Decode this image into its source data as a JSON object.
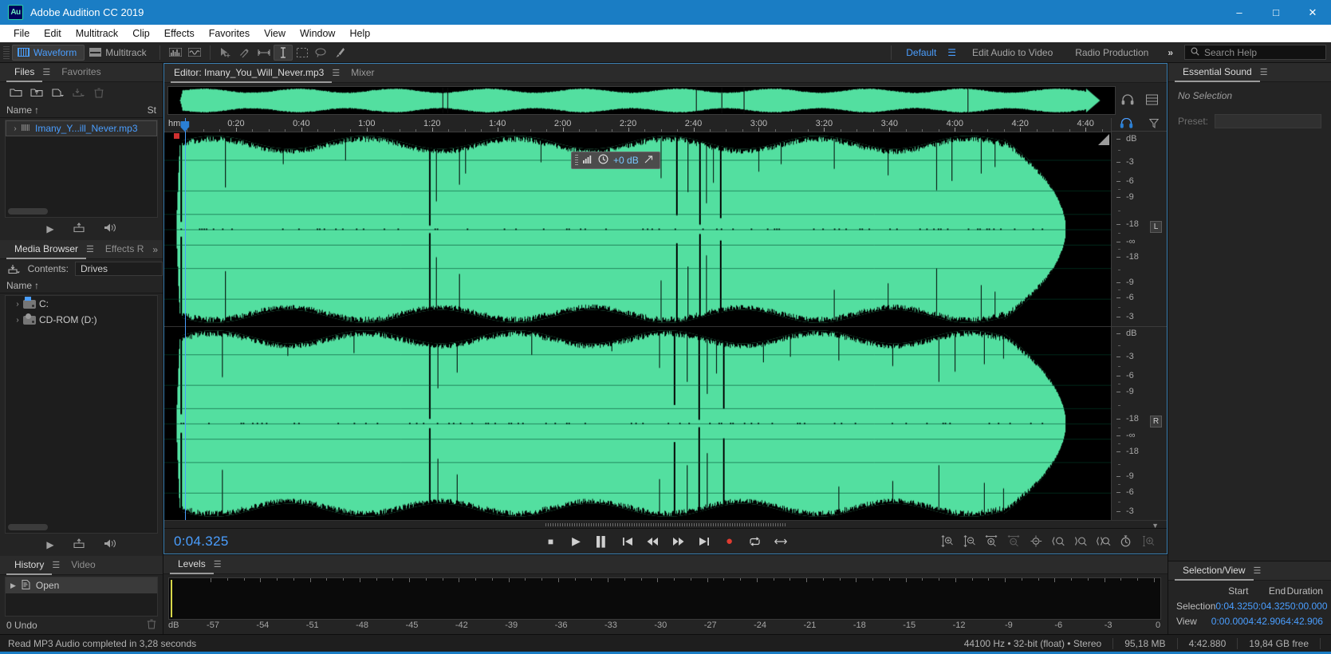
{
  "window": {
    "title": "Adobe Audition CC 2019",
    "logo": "Au",
    "minimize": "–",
    "maximize": "□",
    "close": "✕"
  },
  "menubar": [
    "File",
    "Edit",
    "Multitrack",
    "Clip",
    "Effects",
    "Favorites",
    "View",
    "Window",
    "Help"
  ],
  "toolbar": {
    "waveform": "Waveform",
    "multitrack": "Multitrack",
    "icons": [
      "spectral-frequency-icon",
      "spectral-pitch-icon",
      "move-tool-icon",
      "slip-tool-icon",
      "time-selection-icon",
      "razor-icon",
      "marquee-select-icon",
      "lasso-select-icon",
      "paintbrush-select-icon"
    ],
    "workspaces": [
      "Default",
      "Edit Audio to Video",
      "Radio Production"
    ],
    "workspace_active": "Default",
    "more": "»",
    "search_placeholder": "Search Help"
  },
  "files_panel": {
    "tabs": [
      "Files",
      "Favorites"
    ],
    "active_tab": "Files",
    "column_name": "Name",
    "column_sort_arrow": "↑",
    "column_status": "St",
    "items": [
      {
        "name": "Imany_Y...ill_Never.mp3",
        "selected": true
      }
    ],
    "toolbar_icons": [
      "open-file-icon",
      "import-file-icon",
      "new-file-icon",
      "save-icon",
      "close-file-icon"
    ],
    "transport_icons": [
      "play-icon",
      "insert-into-multitrack-icon",
      "auto-play-icon"
    ]
  },
  "media_browser": {
    "tabs": [
      "Media Browser",
      "Effects R"
    ],
    "active_tab": "Media Browser",
    "more": "»",
    "contents_label": "Contents:",
    "contents_value": "Drives",
    "column_name": "Name",
    "column_sort_arrow": "↑",
    "drives": [
      {
        "label": "C:",
        "icon": "hard-drive-icon"
      },
      {
        "label": "CD-ROM (D:)",
        "icon": "cd-rom-icon"
      }
    ],
    "transport_icons": [
      "play-icon",
      "insert-into-multitrack-icon",
      "auto-play-icon"
    ]
  },
  "history_panel": {
    "tabs": [
      "History",
      "Video"
    ],
    "active_tab": "History",
    "items": [
      {
        "label": "Open"
      }
    ],
    "undo_count": "0 Undo"
  },
  "editor": {
    "tabs": [
      "Editor: Imany_You_Will_Never.mp3",
      "Mixer"
    ],
    "active_tab": "Editor: Imany_You_Will_Never.mp3",
    "overview_icons": [
      "headphones-icon",
      "layout-icon"
    ],
    "ruler_unit": "hms",
    "ruler_labels": [
      "0:20",
      "0:40",
      "1:00",
      "1:20",
      "1:40",
      "2:00",
      "2:20",
      "2:40",
      "3:00",
      "3:20",
      "3:40",
      "4:00",
      "4:20",
      "4:40"
    ],
    "gain_chip": {
      "value": "+0 dB",
      "icons": [
        "levels-icon",
        "clock-icon",
        "arrow-icon"
      ]
    },
    "channel_labels": [
      "L",
      "R"
    ],
    "db_scale_top": [
      "dB",
      "-3",
      "-6",
      "-9",
      "-18",
      "-∞",
      "-18",
      "-9",
      "-6",
      "-3"
    ],
    "db_scale_bottom": [
      "dB",
      "-3",
      "-6",
      "-9",
      "-18",
      "-∞",
      "-18",
      "-9",
      "-6",
      "-3"
    ],
    "headphone_icon": "headphones-icon",
    "funnel_icon": "funnel-icon"
  },
  "transport": {
    "time": "0:04.325",
    "buttons": [
      "stop-button",
      "play-button",
      "pause-button",
      "move-to-previous-button",
      "rewind-button",
      "fast-forward-button",
      "move-to-next-button",
      "record-button",
      "loop-button",
      "skip-button"
    ],
    "zoom_buttons": [
      "zoom-in-amplitude",
      "zoom-out-amplitude",
      "zoom-in-time",
      "zoom-out-time",
      "zoom-out-full",
      "zoom-to-selection-left",
      "zoom-to-selection-right",
      "zoom-to-selection",
      "zoom-to-selection-timer",
      "zoom-in-at-in-point"
    ]
  },
  "levels_panel": {
    "tabs": [
      "Levels"
    ],
    "active_tab": "Levels",
    "db_label": "dB",
    "scale": [
      "-57",
      "-54",
      "-51",
      "-48",
      "-45",
      "-42",
      "-39",
      "-36",
      "-33",
      "-30",
      "-27",
      "-24",
      "-21",
      "-18",
      "-15",
      "-12",
      "-9",
      "-6",
      "-3",
      "0"
    ]
  },
  "essential_sound": {
    "title": "Essential Sound",
    "no_selection": "No Selection",
    "preset_label": "Preset:"
  },
  "selection_view": {
    "title": "Selection/View",
    "headers": [
      "Start",
      "End",
      "Duration"
    ],
    "rows": [
      {
        "label": "Selection",
        "start": "0:04.325",
        "end": "0:04.325",
        "duration": "0:00.000"
      },
      {
        "label": "View",
        "start": "0:00.000",
        "end": "4:42.906",
        "duration": "4:42.906"
      }
    ]
  },
  "statusbar": {
    "message": "Read MP3 Audio completed in 3,28 seconds",
    "sample_rate": "44100 Hz • 32-bit (float) • Stereo",
    "file_size": "95,18 MB",
    "duration": "4:42.880",
    "free_space": "19,84 GB free"
  },
  "colors": {
    "titlebar": "#1a7dc4",
    "accent_blue": "#4a9eff",
    "waveform_green": "#53dfa0",
    "record_red": "#e03c31"
  }
}
